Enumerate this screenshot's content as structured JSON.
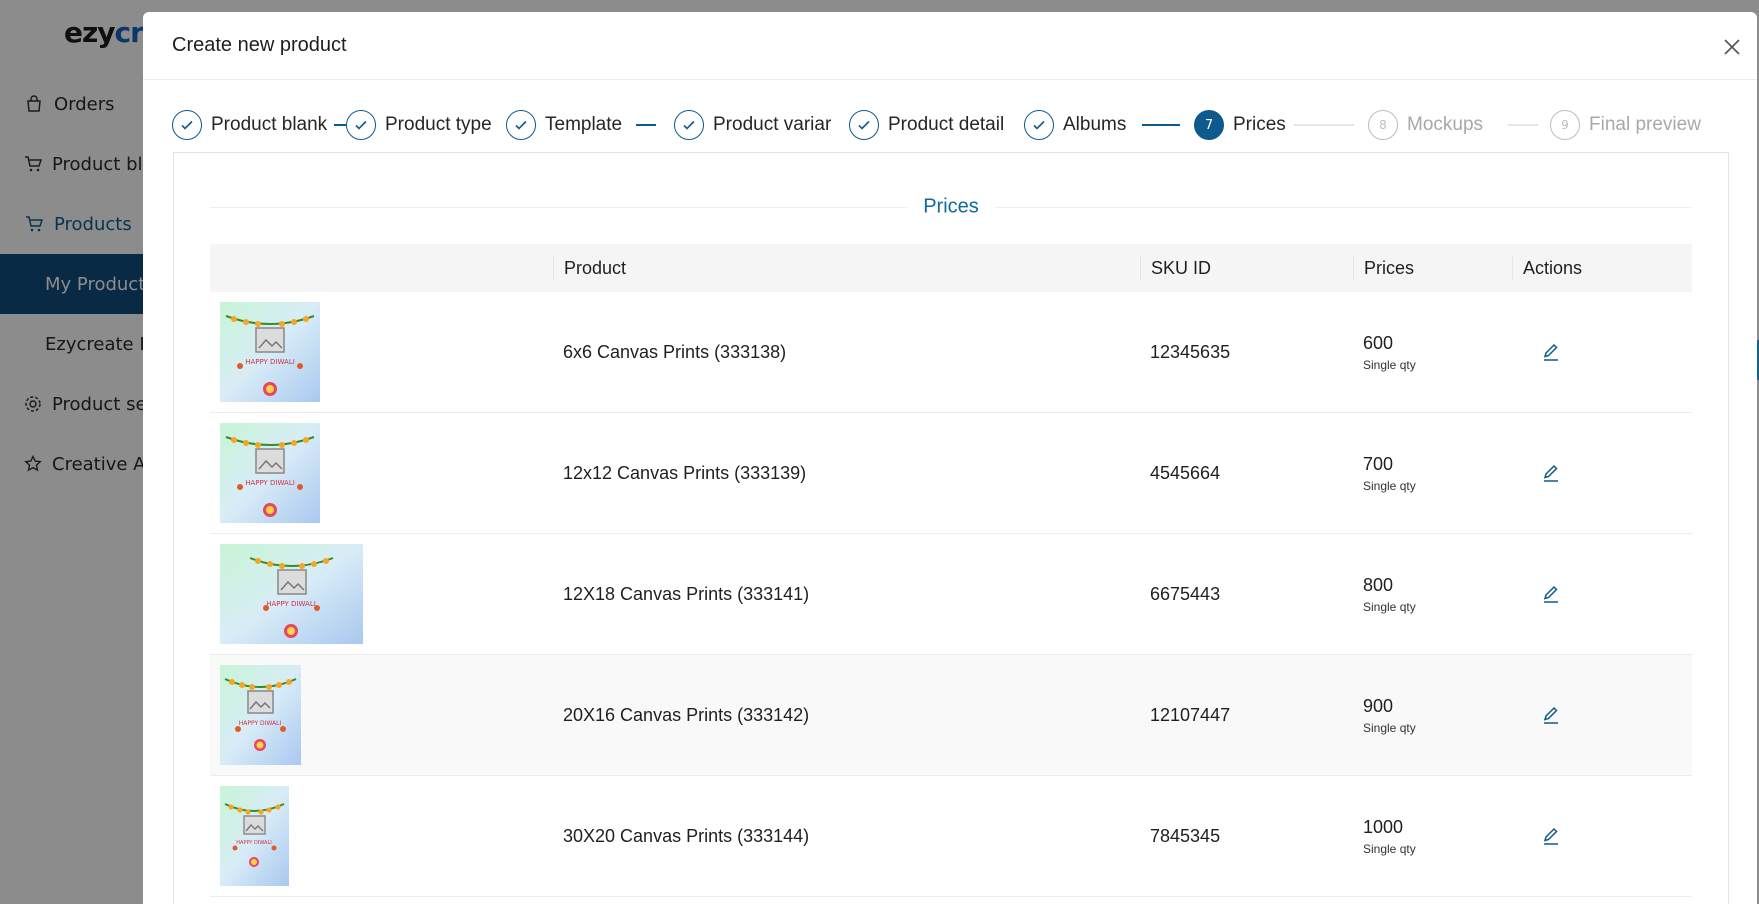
{
  "brand": {
    "part1": "ezy",
    "part2": "cre"
  },
  "sidebar": {
    "items": [
      {
        "label": "Orders"
      },
      {
        "label": "Product bla"
      },
      {
        "label": "Products"
      },
      {
        "label": "My Product"
      },
      {
        "label": "Ezycreate P"
      },
      {
        "label": "Product se"
      },
      {
        "label": "Creative A"
      }
    ]
  },
  "modal": {
    "title": "Create new product",
    "steps": [
      {
        "label": "Product blank",
        "status": "done"
      },
      {
        "label": "Product type",
        "status": "done"
      },
      {
        "label": "Template",
        "status": "done"
      },
      {
        "label": "Product variar",
        "status": "done"
      },
      {
        "label": "Product detail",
        "status": "done"
      },
      {
        "label": "Albums",
        "status": "done"
      },
      {
        "number": "7",
        "label": "Prices",
        "status": "current"
      },
      {
        "number": "8",
        "label": "Mockups",
        "status": "pending"
      },
      {
        "number": "9",
        "label": "Final preview",
        "status": "pending"
      }
    ],
    "section_title": "Prices",
    "table": {
      "headers": [
        "",
        "Product",
        "SKU ID",
        "Prices",
        "Actions"
      ],
      "rows": [
        {
          "product": "6x6 Canvas Prints (333138)",
          "sku": "12345635",
          "price": "600",
          "qty": "Single qty"
        },
        {
          "product": "12x12 Canvas Prints (333139)",
          "sku": "4545664",
          "price": "700",
          "qty": "Single qty"
        },
        {
          "product": "12X18 Canvas Prints (333141)",
          "sku": "6675443",
          "price": "800",
          "qty": "Single qty"
        },
        {
          "product": "20X16 Canvas Prints (333142)",
          "sku": "12107447",
          "price": "900",
          "qty": "Single qty"
        },
        {
          "product": "30X20 Canvas Prints (333144)",
          "sku": "7845345",
          "price": "1000",
          "qty": "Single qty"
        }
      ],
      "thumbnail_text": "HAPPY DIWALI"
    }
  },
  "colors": {
    "accent": "#0f5a8c",
    "active_nav": "#0f4e7c",
    "section_title": "#0f6a9c"
  }
}
